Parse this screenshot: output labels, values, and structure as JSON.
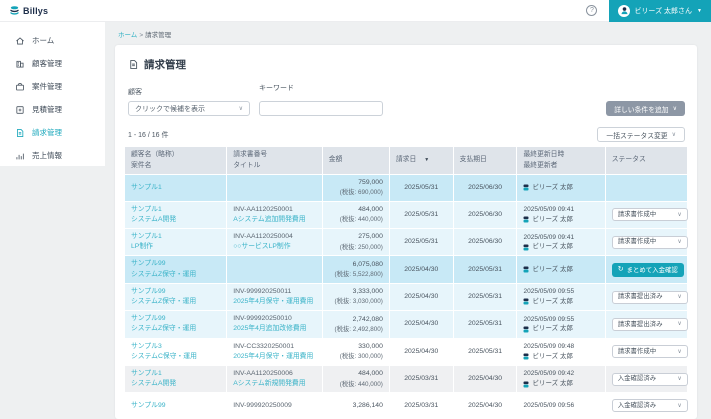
{
  "topbar": {
    "logo_text": "Billys",
    "help_label": "?",
    "user_name": "ビリーズ 太郎さん"
  },
  "sidebar": {
    "items": [
      {
        "id": "home",
        "label": "ホーム",
        "active": false
      },
      {
        "id": "customers",
        "label": "顧客管理",
        "active": false
      },
      {
        "id": "projects",
        "label": "案件管理",
        "active": false
      },
      {
        "id": "estimates",
        "label": "見積管理",
        "active": false
      },
      {
        "id": "invoices",
        "label": "請求管理",
        "active": true
      },
      {
        "id": "sales",
        "label": "売上情報",
        "active": false
      }
    ]
  },
  "breadcrumb": {
    "home": "ホーム",
    "separator": ">",
    "current": "請求管理"
  },
  "main": {
    "title": "請求管理",
    "filters": {
      "customer_label": "顧客",
      "customer_value": "クリックで候補を表示",
      "keyword_label": "キーワード",
      "keyword_value": ""
    },
    "add_condition_label": "詳しい条件を追加",
    "count_text": "1 - 16 / 16 件",
    "bulk_status_label": "一括ステータス変更",
    "table": {
      "headers": {
        "customer_line1": "顧客名（略称）",
        "customer_line2": "案件名",
        "invoice_line1": "請求書番号",
        "invoice_line2": "タイトル",
        "amount": "金額",
        "billing_date": "請求日",
        "due_date": "支払期日",
        "updated_line1": "最終更新日時",
        "updated_line2": "最終更新者",
        "status": "ステータス"
      },
      "rows": [
        {
          "style": "group-head",
          "customer": "サンプル1",
          "project": "",
          "invoice_no": "",
          "invoice_title": "",
          "amount": "759,000",
          "amount_tax": "(税抜: 690,000)",
          "billing_date": "2025/05/31",
          "due_date": "2025/06/30",
          "updated_at": "",
          "updated_by": "ビリーズ 太郎",
          "status": {
            "type": "none",
            "label": ""
          }
        },
        {
          "style": "group-detail",
          "customer": "サンプル1",
          "project": "システムA開発",
          "invoice_no": "INV-AA1120250001",
          "invoice_title": "Aシステム追加開発費用",
          "amount": "484,000",
          "amount_tax": "(税抜: 440,000)",
          "billing_date": "2025/05/31",
          "due_date": "2025/06/30",
          "updated_at": "2025/05/09 09:41",
          "updated_by": "ビリーズ 太郎",
          "status": {
            "type": "select",
            "label": "請求書作成中"
          }
        },
        {
          "style": "group-detail",
          "customer": "サンプル1",
          "project": "LP制作",
          "invoice_no": "INV-AA1120250004",
          "invoice_title": "○○サービスLP制作",
          "amount": "275,000",
          "amount_tax": "(税抜: 250,000)",
          "billing_date": "2025/05/31",
          "due_date": "2025/06/30",
          "updated_at": "2025/05/09 09:41",
          "updated_by": "ビリーズ 太郎",
          "status": {
            "type": "select",
            "label": "請求書作成中"
          }
        },
        {
          "style": "group-head",
          "customer": "サンプル99",
          "project": "システムZ保守・運用",
          "invoice_no": "",
          "invoice_title": "",
          "amount": "6,075,080",
          "amount_tax": "(税抜: 5,522,800)",
          "billing_date": "2025/04/30",
          "due_date": "2025/05/31",
          "updated_at": "",
          "updated_by": "ビリーズ 太郎",
          "status": {
            "type": "button",
            "label": "まとめて入金確認"
          }
        },
        {
          "style": "group-detail",
          "customer": "サンプル99",
          "project": "システムZ保守・運用",
          "invoice_no": "INV-999920250011",
          "invoice_title": "2025年4月保守・運用費用",
          "amount": "3,333,000",
          "amount_tax": "(税抜: 3,030,000)",
          "billing_date": "2025/04/30",
          "due_date": "2025/05/31",
          "updated_at": "2025/05/09 09:55",
          "updated_by": "ビリーズ 太郎",
          "status": {
            "type": "select",
            "label": "請求書提出済み"
          }
        },
        {
          "style": "group-detail",
          "customer": "サンプル99",
          "project": "システムZ保守・運用",
          "invoice_no": "INV-999920250010",
          "invoice_title": "2025年4月追加改修費用",
          "amount": "2,742,080",
          "amount_tax": "(税抜: 2,492,800)",
          "billing_date": "2025/04/30",
          "due_date": "2025/05/31",
          "updated_at": "2025/05/09 09:55",
          "updated_by": "ビリーズ 太郎",
          "status": {
            "type": "select",
            "label": "請求書提出済み"
          }
        },
        {
          "style": "plain",
          "customer": "サンプル3",
          "project": "システムC保守・運用",
          "invoice_no": "INV-CC3320250001",
          "invoice_title": "2025年4月保守・運用費用",
          "amount": "330,000",
          "amount_tax": "(税抜: 300,000)",
          "billing_date": "2025/04/30",
          "due_date": "2025/05/31",
          "updated_at": "2025/05/09 09:48",
          "updated_by": "ビリーズ 太郎",
          "status": {
            "type": "select",
            "label": "請求書作成中"
          }
        },
        {
          "style": "alt",
          "customer": "サンプル1",
          "project": "システムA開発",
          "invoice_no": "INV-AA1120250006",
          "invoice_title": "Aシステム新規開発費用",
          "amount": "484,000",
          "amount_tax": "(税抜: 440,000)",
          "billing_date": "2025/03/31",
          "due_date": "2025/04/30",
          "updated_at": "2025/05/09 09:42",
          "updated_by": "ビリーズ 太郎",
          "status": {
            "type": "select",
            "label": "入金確認済み"
          }
        },
        {
          "style": "plain",
          "customer": "サンプル99",
          "project": "",
          "invoice_no": "INV-999920250009",
          "invoice_title": "",
          "amount": "3,286,140",
          "amount_tax": "",
          "billing_date": "2025/03/31",
          "due_date": "2025/04/30",
          "updated_at": "2025/05/09 09:56",
          "updated_by": "",
          "status": {
            "type": "select",
            "label": "入金確認済み"
          }
        }
      ]
    }
  },
  "colors": {
    "accent_teal": "#14a3b8",
    "link_teal": "#3ab3c8",
    "navy": "#1d2e4a",
    "header_bg": "#dfe4ea",
    "group_row": "#c8e9f6",
    "detail_row": "#e7f5fb",
    "alt_row": "#eff0f2"
  }
}
